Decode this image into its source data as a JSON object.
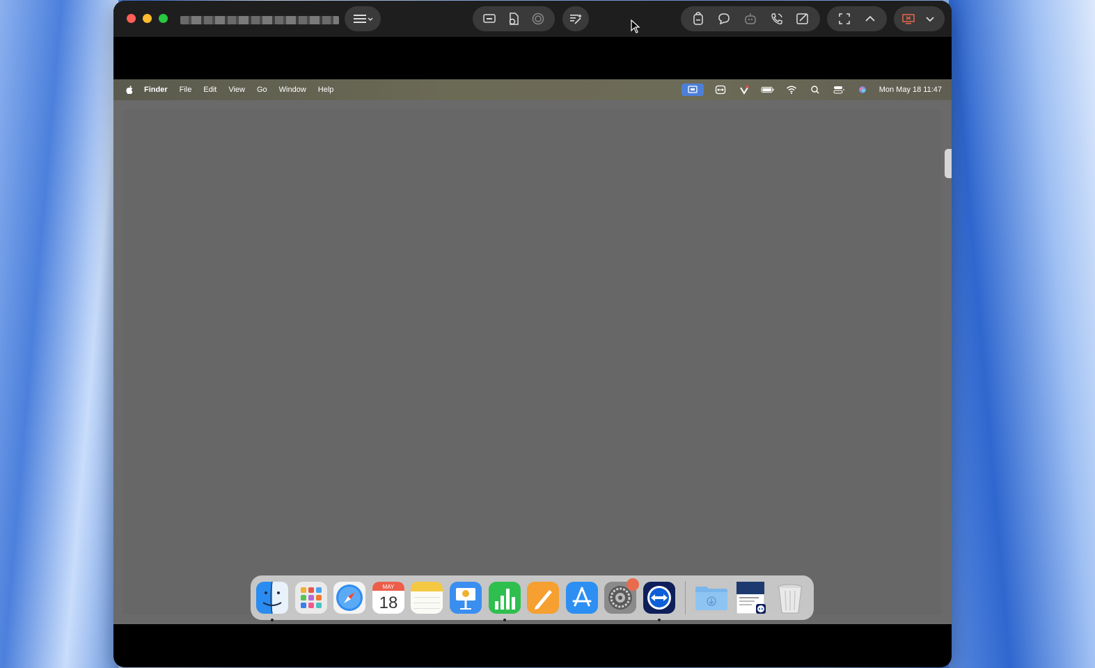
{
  "window": {
    "title": "██████ ██████████ ██████"
  },
  "toolbar": {
    "left_group": [
      {
        "icon": "hamburger-menu-icon"
      }
    ],
    "center_group": [
      {
        "icon": "screen-share-icon"
      },
      {
        "icon": "file-transfer-icon"
      },
      {
        "icon": "record-icon"
      }
    ],
    "extra": [
      {
        "icon": "magic-wand-icon"
      }
    ],
    "right_group": [
      {
        "icon": "clipboard-icon"
      },
      {
        "icon": "chat-icon"
      },
      {
        "icon": "robot-icon"
      },
      {
        "icon": "phone-icon"
      },
      {
        "icon": "whiteboard-icon"
      }
    ],
    "view_group": [
      {
        "icon": "fullscreen-icon"
      },
      {
        "icon": "chevron-up-icon"
      }
    ],
    "end_group": [
      {
        "icon": "end-session-icon"
      },
      {
        "icon": "chevron-down-icon"
      }
    ]
  },
  "menubar": {
    "app_name": "Finder",
    "items": [
      "File",
      "Edit",
      "View",
      "Go",
      "Window",
      "Help"
    ],
    "clock": "Mon May 18  11:47"
  },
  "calendar": {
    "month": "MAY",
    "day": "18"
  },
  "dock": {
    "apps": [
      {
        "name": "Finder",
        "icon": "finder-icon",
        "running": true
      },
      {
        "name": "Launchpad",
        "icon": "launchpad-icon",
        "running": false
      },
      {
        "name": "Safari",
        "icon": "safari-icon",
        "running": false
      },
      {
        "name": "Calendar",
        "icon": "calendar-icon",
        "running": false
      },
      {
        "name": "Notes",
        "icon": "notes-icon",
        "running": false
      },
      {
        "name": "Keynote",
        "icon": "keynote-icon",
        "running": false
      },
      {
        "name": "Numbers",
        "icon": "numbers-icon",
        "running": true
      },
      {
        "name": "Pages",
        "icon": "pages-icon",
        "running": false
      },
      {
        "name": "App Store",
        "icon": "app-store-icon",
        "running": false
      },
      {
        "name": "System Settings",
        "icon": "system-settings-icon",
        "running": false
      },
      {
        "name": "TeamViewer",
        "icon": "teamviewer-icon",
        "running": true
      }
    ],
    "others": [
      {
        "name": "Downloads",
        "icon": "downloads-folder-icon"
      },
      {
        "name": "Document",
        "icon": "document-thumbnail-icon"
      },
      {
        "name": "Trash",
        "icon": "trash-icon"
      }
    ]
  },
  "colors": {
    "toolbar_bg": "#1e1e1e",
    "pill_bg": "#3a3a3a",
    "desktop_bg": "#676767",
    "accent_blue": "#4d7fd6",
    "badge": "#e96b4e"
  }
}
